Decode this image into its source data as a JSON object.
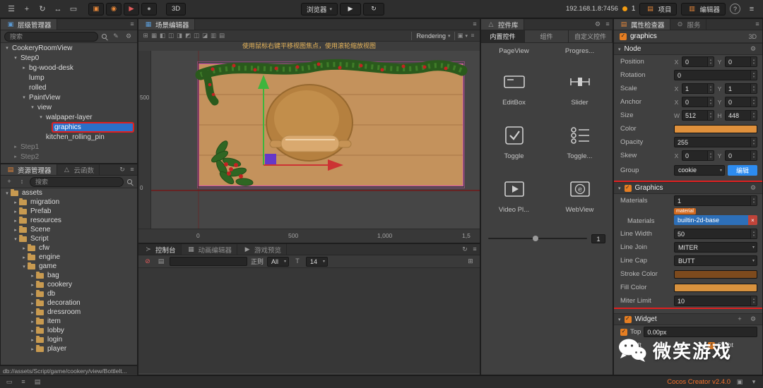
{
  "toolbar": {
    "tools": [
      {
        "name": "menu-icon"
      },
      {
        "name": "move-tool-icon"
      },
      {
        "name": "rotate-tool-icon"
      },
      {
        "name": "scale-tool-icon"
      },
      {
        "name": "rect-tool-icon"
      }
    ],
    "mode_buttons": [
      {
        "name": "pivot-toggle-icon"
      },
      {
        "name": "coord-toggle-icon"
      },
      {
        "name": "build-icon"
      },
      {
        "name": "record-icon"
      }
    ],
    "mode_3d": "3D",
    "preview_target": "浏览器",
    "ip": "192.168.1.8:7456",
    "connected_count": "1",
    "project_btn": "项目",
    "editor_btn": "编辑器"
  },
  "hierarchy": {
    "title": "层级管理器",
    "search_placeholder": "搜索",
    "items": [
      {
        "label": "CookeryRoomView",
        "indent": 0,
        "arrow": "down"
      },
      {
        "label": "Step0",
        "indent": 1,
        "arrow": "down"
      },
      {
        "label": "bg-wood-desk",
        "indent": 2,
        "arrow": "right"
      },
      {
        "label": "lump",
        "indent": 2,
        "arrow": "none"
      },
      {
        "label": "rolled",
        "indent": 2,
        "arrow": "none"
      },
      {
        "label": "PaintView",
        "indent": 2,
        "arrow": "down"
      },
      {
        "label": "view",
        "indent": 3,
        "arrow": "down"
      },
      {
        "label": "walpaper-layer",
        "indent": 4,
        "arrow": "down"
      },
      {
        "label": "graphics",
        "indent": 5,
        "arrow": "none",
        "selected": true
      },
      {
        "label": "kitchen_rolling_pin",
        "indent": 4,
        "arrow": "none"
      },
      {
        "label": "Step1",
        "indent": 1,
        "arrow": "right",
        "dimmed": true
      },
      {
        "label": "Step2",
        "indent": 1,
        "arrow": "right",
        "dimmed": true
      }
    ]
  },
  "assets": {
    "tab_assets": "资源管理器",
    "tab_cloud": "云函数",
    "search_placeholder": "搜索",
    "path": "db://assets/Script/game/cookery/view/Bottlelt...",
    "items": [
      {
        "label": "assets",
        "indent": 0,
        "arrow": "down"
      },
      {
        "label": "migration",
        "indent": 1,
        "arrow": "right"
      },
      {
        "label": "Prefab",
        "indent": 1,
        "arrow": "right"
      },
      {
        "label": "resources",
        "indent": 1,
        "arrow": "right"
      },
      {
        "label": "Scene",
        "indent": 1,
        "arrow": "right"
      },
      {
        "label": "Script",
        "indent": 1,
        "arrow": "down"
      },
      {
        "label": "cfw",
        "indent": 2,
        "arrow": "right"
      },
      {
        "label": "engine",
        "indent": 2,
        "arrow": "right"
      },
      {
        "label": "game",
        "indent": 2,
        "arrow": "down"
      },
      {
        "label": "bag",
        "indent": 3,
        "arrow": "right"
      },
      {
        "label": "cookery",
        "indent": 3,
        "arrow": "right"
      },
      {
        "label": "db",
        "indent": 3,
        "arrow": "right"
      },
      {
        "label": "decoration",
        "indent": 3,
        "arrow": "right"
      },
      {
        "label": "dressroom",
        "indent": 3,
        "arrow": "right"
      },
      {
        "label": "item",
        "indent": 3,
        "arrow": "right"
      },
      {
        "label": "lobby",
        "indent": 3,
        "arrow": "right"
      },
      {
        "label": "login",
        "indent": 3,
        "arrow": "right"
      },
      {
        "label": "player",
        "indent": 3,
        "arrow": "right"
      }
    ]
  },
  "scene": {
    "title": "场景编辑器",
    "hint": "使用鼠标右键平移视图焦点，使用滚轮缩放视图",
    "rendering_label": "Rendering",
    "toolbar_icons": [
      {
        "name": "snap-icon"
      },
      {
        "name": "grid-icon"
      },
      {
        "name": "align-left-icon"
      },
      {
        "name": "align-center-h-icon"
      },
      {
        "name": "align-right-icon"
      },
      {
        "name": "align-top-icon"
      },
      {
        "name": "align-middle-icon"
      },
      {
        "name": "align-bottom-icon"
      },
      {
        "name": "distribute-h-icon"
      },
      {
        "name": "distribute-v-icon"
      }
    ],
    "ruler_v": [
      "500",
      "0"
    ],
    "ruler_h": [
      "0",
      "500",
      "1,000",
      "1,5"
    ],
    "colors": {
      "wood": "#c4925c",
      "dough": "#b5803f",
      "pin": "#d9a96f",
      "pin_handle": "#c69355",
      "garland": "#2a5a1c",
      "berry": "#c42222",
      "gizmo_x": "#cc3333",
      "gizmo_y": "#3db53d",
      "gizmo_plane": "#5b2fd4",
      "bounds": "#d94fb0"
    }
  },
  "console": {
    "tab_console": "控制台",
    "tab_anim": "动画编辑器",
    "tab_preview": "游戏预览",
    "regex_label": "正则",
    "filter_value": "All",
    "fontsize_value": "14"
  },
  "library": {
    "title": "控件库",
    "tab_builtin": "内置控件",
    "tab_component": "组件",
    "tab_custom": "自定义控件",
    "footer_value": "1",
    "items": [
      {
        "label": "PageView",
        "icon": "pageview",
        "partial": true
      },
      {
        "label": "Progres...",
        "icon": "progress",
        "partial": true
      },
      {
        "label": "EditBox",
        "icon": "editbox"
      },
      {
        "label": "Slider",
        "icon": "slider"
      },
      {
        "label": "Toggle",
        "icon": "toggle"
      },
      {
        "label": "Toggle...",
        "icon": "toggle-group"
      },
      {
        "label": "Video Pl...",
        "icon": "video"
      },
      {
        "label": "WebView",
        "icon": "webview"
      }
    ]
  },
  "inspector": {
    "tab_inspector": "属性检查器",
    "tab_service": "服务",
    "node_name": "graphics",
    "mode_3d": "3D",
    "axis_x": "X",
    "axis_y": "Y",
    "axis_w": "W",
    "axis_h": "H",
    "node_section_title": "Node",
    "position_label": "Position",
    "position_x": "0",
    "position_y": "0",
    "rotation_label": "Rotation",
    "rotation": "0",
    "scale_label": "Scale",
    "scale_x": "1",
    "scale_y": "1",
    "anchor_label": "Anchor",
    "anchor_x": "0",
    "anchor_y": "0",
    "size_label": "Size",
    "size_w": "512",
    "size_h": "448",
    "color_label": "Color",
    "color_value": "#e0913c",
    "opacity_label": "Opacity",
    "opacity": "255",
    "skew_label": "Skew",
    "skew_x": "0",
    "skew_y": "0",
    "group_label": "Group",
    "group_value": "cookie",
    "group_edit": "编辑",
    "graphics": {
      "title": "Graphics",
      "materials_label": "Materials",
      "materials_count": "1",
      "material_badge": "material",
      "material_item_label": "Materials",
      "material_value": "builtin-2d-base",
      "line_width_label": "Line Width",
      "line_width": "50",
      "line_join_label": "Line Join",
      "line_join": "MITER",
      "line_cap_label": "Line Cap",
      "line_cap": "BUTT",
      "stroke_color_label": "Stroke Color",
      "stroke_color": "#7d4a1d",
      "fill_color_label": "Fill Color",
      "fill_color": "#d8923e",
      "miter_limit_label": "Miter Limit",
      "miter_limit": "10"
    },
    "widget": {
      "title": "Widget",
      "top_label": "Top",
      "top_value": "0.00px",
      "left_label": "Left",
      "right_label": "Right"
    }
  },
  "statusbar": {
    "version": "Cocos Creator v2.4.0"
  },
  "watermark": {
    "text": "微笑游戏"
  }
}
